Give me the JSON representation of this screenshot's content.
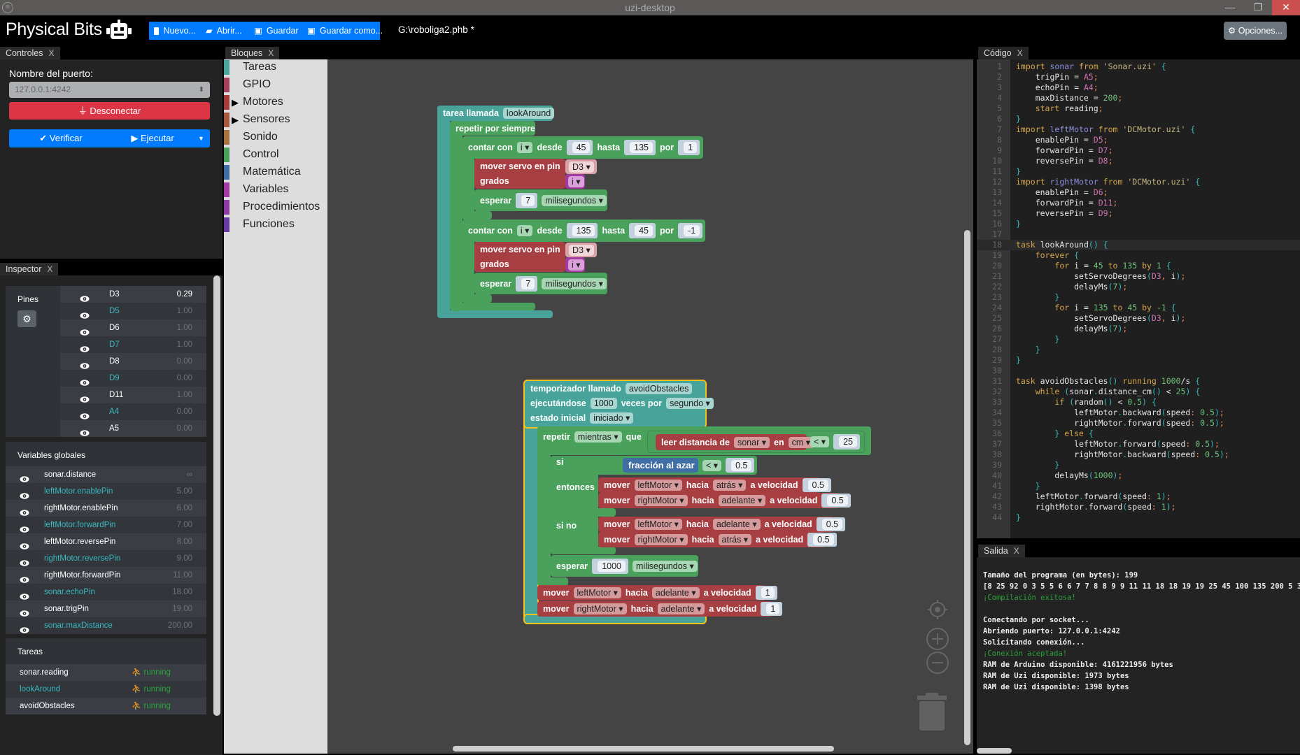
{
  "window": {
    "title": "uzi-desktop",
    "minimize": "—",
    "maximize": "❐",
    "close": "✕"
  },
  "header": {
    "logo": "Physical Bits",
    "file": "G:\\roboliga2.phb *",
    "options": "Opciones...",
    "toolbar": [
      {
        "label": "Nuevo...",
        "icon": "file-icon"
      },
      {
        "label": "Abrir...",
        "icon": "folder-open-icon"
      },
      {
        "label": "Guardar",
        "icon": "save-icon"
      },
      {
        "label": "Guardar como...",
        "icon": "save-icon"
      }
    ]
  },
  "tabs": {
    "controls": "Controles",
    "blocks": "Bloques",
    "code": "Código",
    "inspector": "Inspector",
    "output": "Salida",
    "close": "X"
  },
  "controls": {
    "port_label": "Nombre del puerto:",
    "port_value": "127.0.0.1:4242",
    "disconnect": "Desconectar",
    "verify": "Verificar",
    "run": "Ejecutar"
  },
  "inspector": {
    "pins_title": "Pines",
    "pins": [
      {
        "name": "D3",
        "value": "0.29",
        "active": true
      },
      {
        "name": "D5",
        "value": "1.00"
      },
      {
        "name": "D6",
        "value": "1.00"
      },
      {
        "name": "D7",
        "value": "1.00"
      },
      {
        "name": "D8",
        "value": "0.00"
      },
      {
        "name": "D9",
        "value": "0.00"
      },
      {
        "name": "D11",
        "value": "1.00"
      },
      {
        "name": "A4",
        "value": "0.00"
      },
      {
        "name": "A5",
        "value": "0.00"
      }
    ],
    "globals_title": "Variables globales",
    "globals": [
      {
        "name": "sonar.distance",
        "value": "∞"
      },
      {
        "name": "leftMotor.enablePin",
        "value": "5.00"
      },
      {
        "name": "rightMotor.enablePin",
        "value": "6.00"
      },
      {
        "name": "leftMotor.forwardPin",
        "value": "7.00"
      },
      {
        "name": "leftMotor.reversePin",
        "value": "8.00"
      },
      {
        "name": "rightMotor.reversePin",
        "value": "9.00"
      },
      {
        "name": "rightMotor.forwardPin",
        "value": "11.00"
      },
      {
        "name": "sonar.echoPin",
        "value": "18.00"
      },
      {
        "name": "sonar.trigPin",
        "value": "19.00"
      },
      {
        "name": "sonar.maxDistance",
        "value": "200.00"
      }
    ],
    "tasks_title": "Tareas",
    "tasks": [
      {
        "name": "sonar.reading",
        "state": "running"
      },
      {
        "name": "lookAround",
        "state": "running"
      },
      {
        "name": "avoidObstacles",
        "state": "running"
      }
    ]
  },
  "toolbox": [
    {
      "label": "Tareas",
      "color": "#49a59c"
    },
    {
      "label": "GPIO",
      "color": "#a33f5a"
    },
    {
      "label": "Motores",
      "color": "#a53d3f",
      "expandable": true
    },
    {
      "label": "Sensores",
      "color": "#a5583f",
      "expandable": true
    },
    {
      "label": "Sonido",
      "color": "#a5743f"
    },
    {
      "label": "Control",
      "color": "#4aa15c"
    },
    {
      "label": "Matemática",
      "color": "#3f6ea4"
    },
    {
      "label": "Variables",
      "color": "#a33aa3"
    },
    {
      "label": "Procedimientos",
      "color": "#8e3aa5"
    },
    {
      "label": "Funciones",
      "color": "#6a3aa5"
    }
  ],
  "blocks": {
    "task": {
      "label": "tarea llamada",
      "name": "lookAround",
      "forever": "repetir por siempre",
      "loops": [
        {
          "label": "contar con",
          "var": "i",
          "from_label": "desde",
          "from": "45",
          "to_label": "hasta",
          "to": "135",
          "by_label": "por",
          "by": "1"
        },
        {
          "label": "contar con",
          "var": "i",
          "from_label": "desde",
          "from": "135",
          "to_label": "hasta",
          "to": "45",
          "by_label": "por",
          "by": "-1"
        }
      ],
      "servo": "mover servo en pin",
      "pin": "D3",
      "degrees": "grados",
      "degvar": "i",
      "wait": "esperar",
      "wait_value": "7",
      "wait_unit": "milisegundos"
    },
    "timer": {
      "label": "temporizador llamado",
      "name": "avoidObstacles",
      "running": "ejecutándose",
      "rate": "1000",
      "per": "veces por",
      "unit": "segundo",
      "state_label": "estado inicial",
      "state": "iniciado",
      "repeat": "repetir",
      "mode": "mientras",
      "that": "que",
      "read": "leer distancia de",
      "sensor": "sonar",
      "in": "en",
      "cm": "cm",
      "op": "<",
      "limit": "25",
      "if": "si",
      "random": "fracción al azar",
      "op2": "<",
      "threshold": "0.5",
      "then": "entonces",
      "else": "si no",
      "move": "mover",
      "toward": "hacia",
      "speed_label": "a velocidad",
      "then_moves": [
        {
          "motor": "leftMotor",
          "dir": "atrás",
          "speed": "0.5"
        },
        {
          "motor": "rightMotor",
          "dir": "adelante",
          "speed": "0.5"
        }
      ],
      "else_moves": [
        {
          "motor": "leftMotor",
          "dir": "adelante",
          "speed": "0.5"
        },
        {
          "motor": "rightMotor",
          "dir": "atrás",
          "speed": "0.5"
        }
      ],
      "wait": "esperar",
      "wait_value": "1000",
      "wait_unit": "milisegundos",
      "after_moves": [
        {
          "motor": "leftMotor",
          "dir": "adelante",
          "speed": "1"
        },
        {
          "motor": "rightMotor",
          "dir": "adelante",
          "speed": "1"
        }
      ]
    }
  },
  "code": [
    "import sonar from 'Sonar.uzi' {",
    "    trigPin = A5;",
    "    echoPin = A4;",
    "    maxDistance = 200;",
    "    start reading;",
    "}",
    "import leftMotor from 'DCMotor.uzi' {",
    "    enablePin = D5;",
    "    forwardPin = D7;",
    "    reversePin = D8;",
    "}",
    "import rightMotor from 'DCMotor.uzi' {",
    "    enablePin = D6;",
    "    forwardPin = D11;",
    "    reversePin = D9;",
    "}",
    "",
    "task lookAround() {",
    "    forever {",
    "        for i = 45 to 135 by 1 {",
    "            setServoDegrees(D3, i);",
    "            delayMs(7);",
    "        }",
    "        for i = 135 to 45 by -1 {",
    "            setServoDegrees(D3, i);",
    "            delayMs(7);",
    "        }",
    "    }",
    "}",
    "",
    "task avoidObstacles() running 1000/s {",
    "    while (sonar.distance_cm() < 25) {",
    "        if (random() < 0.5) {",
    "            leftMotor.backward(speed: 0.5);",
    "            rightMotor.forward(speed: 0.5);",
    "        } else {",
    "            leftMotor.forward(speed: 0.5);",
    "            rightMotor.backward(speed: 0.5);",
    "        }",
    "        delayMs(1000);",
    "    }",
    "    leftMotor.forward(speed: 1);",
    "    rightMotor.forward(speed: 1);",
    "}"
  ],
  "output": [
    {
      "text": "Tamaño del programa (en bytes): 199"
    },
    {
      "text": "[8 25 92 0 3 5 5 6 6 7 7 8 8 9 9 11 11 18 18 19 19 25 45 100 135 200 5 3"
    },
    {
      "text": "¡Compilación exitosa!",
      "success": true
    },
    {
      "text": ""
    },
    {
      "text": "Conectando por socket..."
    },
    {
      "text": "Abriendo puerto: 127.0.0.1:4242"
    },
    {
      "text": "Solicitando conexión..."
    },
    {
      "text": "¡Conexión aceptada!",
      "success": true
    },
    {
      "text": "RAM de Arduino disponible: 4161221956 bytes"
    },
    {
      "text": "RAM de Uzi disponible: 1973 bytes"
    },
    {
      "text": "RAM de Uzi disponible: 1398 bytes"
    }
  ],
  "colors": {
    "primary": "#007bff",
    "danger": "#dc3545",
    "success": "#2aa33a",
    "selected_outline": "#f4c21a"
  }
}
